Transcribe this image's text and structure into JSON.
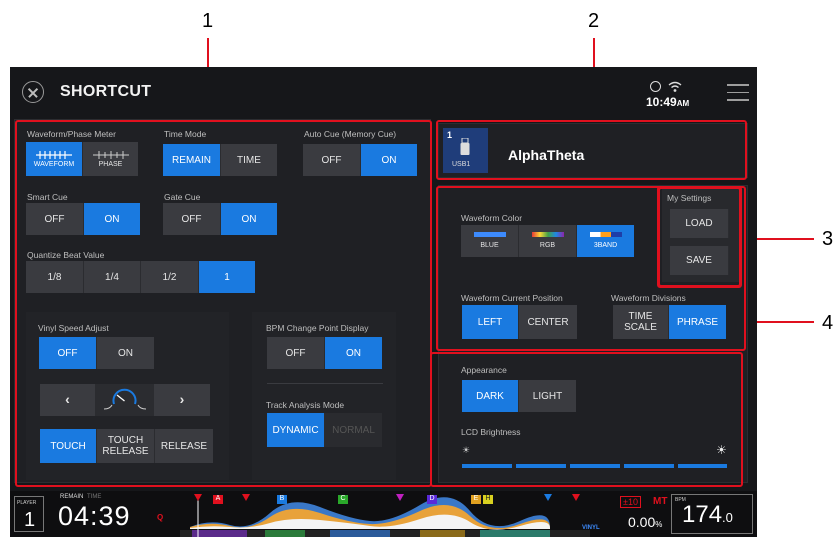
{
  "callouts": {
    "n1": "1",
    "n2": "2",
    "n3": "3",
    "n4": "4"
  },
  "header": {
    "title": "SHORTCUT",
    "time": "10:49",
    "ampm": "AM"
  },
  "left": {
    "waveform_phase_meter": {
      "label": "Waveform/Phase Meter",
      "options": [
        "WAVEFORM",
        "PHASE"
      ],
      "selected": "WAVEFORM"
    },
    "time_mode": {
      "label": "Time Mode",
      "options": [
        "REMAIN",
        "TIME"
      ],
      "selected": "REMAIN"
    },
    "auto_cue": {
      "label": "Auto Cue (Memory Cue)",
      "options": [
        "OFF",
        "ON"
      ],
      "selected": "ON"
    },
    "smart_cue": {
      "label": "Smart Cue",
      "options": [
        "OFF",
        "ON"
      ],
      "selected": "ON"
    },
    "gate_cue": {
      "label": "Gate Cue",
      "options": [
        "OFF",
        "ON"
      ],
      "selected": "ON"
    },
    "quantize": {
      "label": "Quantize Beat Value",
      "options": [
        "1/8",
        "1/4",
        "1/2",
        "1"
      ],
      "selected": "1"
    },
    "vinyl_speed": {
      "label": "Vinyl Speed Adjust",
      "options": [
        "OFF",
        "ON"
      ],
      "selected": "OFF",
      "mode_options": [
        "TOUCH",
        "TOUCH RELEASE",
        "RELEASE"
      ],
      "mode_selected": "TOUCH"
    },
    "bpm_change": {
      "label": "BPM Change Point Display",
      "options": [
        "OFF",
        "ON"
      ],
      "selected": "ON"
    },
    "track_analysis": {
      "label": "Track Analysis Mode",
      "options": [
        "DYNAMIC",
        "NORMAL"
      ],
      "selected": "DYNAMIC"
    }
  },
  "usb": {
    "slot": "1",
    "device": "USB1",
    "name": "AlphaTheta"
  },
  "waveform_color": {
    "label": "Waveform Color",
    "options": [
      "BLUE",
      "RGB",
      "3BAND"
    ],
    "selected": "3BAND"
  },
  "waveform_pos": {
    "label": "Waveform Current Position",
    "options": [
      "LEFT",
      "CENTER"
    ],
    "selected": "LEFT"
  },
  "waveform_div": {
    "label": "Waveform Divisions",
    "options": [
      "TIME SCALE",
      "PHRASE"
    ],
    "selected": "PHRASE"
  },
  "my_settings": {
    "label": "My Settings",
    "load": "LOAD",
    "save": "SAVE"
  },
  "appearance": {
    "label": "Appearance",
    "options": [
      "DARK",
      "LIGHT"
    ],
    "selected": "DARK"
  },
  "lcd": {
    "label": "LCD Brightness",
    "level": 5,
    "max": 5
  },
  "footer": {
    "player_label": "PLAYER",
    "player": "1",
    "remain_label": "REMAIN",
    "time_label": "TIME",
    "time": "04:39",
    "q": "Q",
    "cue_labels": [
      "A",
      "B",
      "C",
      "D",
      "E",
      "H"
    ],
    "vinyl": "VINYL",
    "pitch_range": "±10",
    "mt": "MT",
    "pitch": "0.00",
    "pitch_unit": "%",
    "bpm_label": "BPM",
    "bpm": "174",
    "bpm_dec": ".0"
  },
  "colors": {
    "accent": "#1a7ae0",
    "callout": "#e0101e",
    "bg": "#16171a"
  }
}
